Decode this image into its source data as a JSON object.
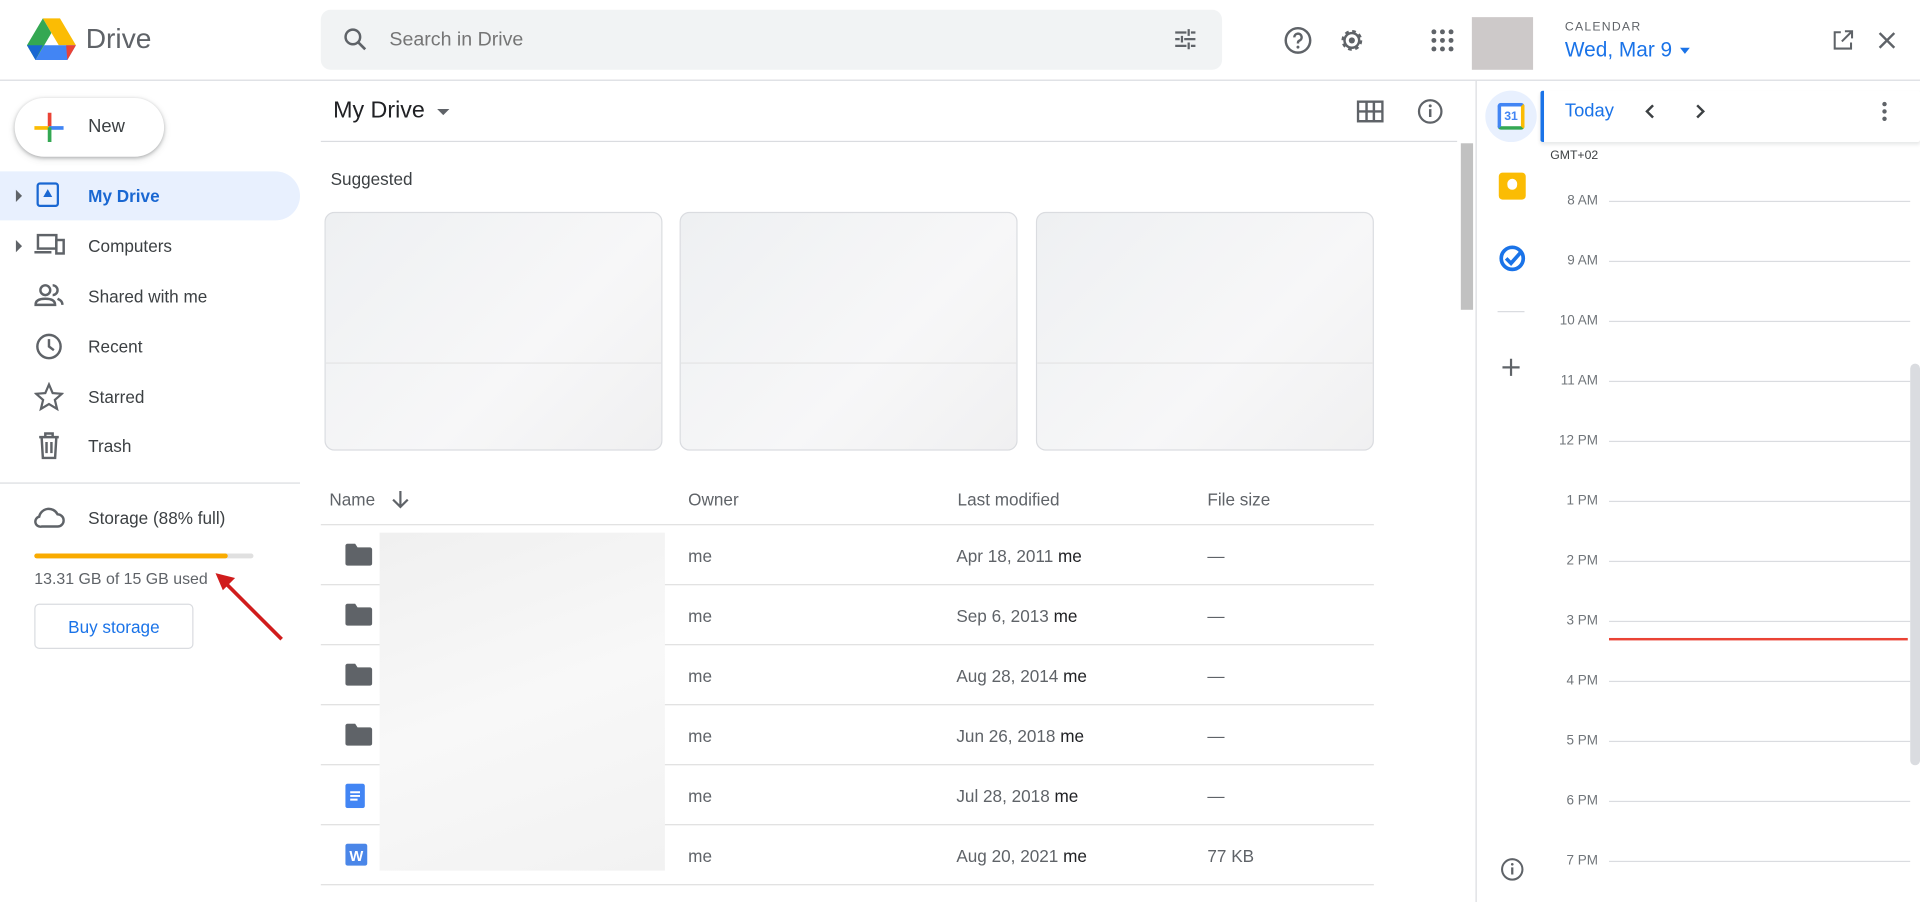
{
  "header": {
    "app_name": "Drive",
    "search_placeholder": "Search in Drive"
  },
  "calendar_header": {
    "label": "CALENDAR",
    "date": "Wed, Mar 9"
  },
  "sidebar": {
    "new_label": "New",
    "items": [
      {
        "label": "My Drive"
      },
      {
        "label": "Computers"
      },
      {
        "label": "Shared with me"
      },
      {
        "label": "Recent"
      },
      {
        "label": "Starred"
      },
      {
        "label": "Trash"
      }
    ],
    "storage": {
      "label": "Storage (88% full)",
      "used_text": "13.31 GB of 15 GB used",
      "percent": 88,
      "buy_label": "Buy storage"
    }
  },
  "main": {
    "title": "My Drive",
    "suggested_label": "Suggested",
    "columns": {
      "name": "Name",
      "owner": "Owner",
      "modified": "Last modified",
      "size": "File size"
    },
    "rows": [
      {
        "type": "folder",
        "owner": "me",
        "modified": "Apr 18, 2011",
        "modified_by": "me",
        "size": "—"
      },
      {
        "type": "folder",
        "owner": "me",
        "modified": "Sep 6, 2013",
        "modified_by": "me",
        "size": "—"
      },
      {
        "type": "folder",
        "owner": "me",
        "modified": "Aug 28, 2014",
        "modified_by": "me",
        "size": "—"
      },
      {
        "type": "folder",
        "owner": "me",
        "modified": "Jun 26, 2018",
        "modified_by": "me",
        "size": "—"
      },
      {
        "type": "doc",
        "owner": "me",
        "modified": "Jul 28, 2018",
        "modified_by": "me",
        "size": "—"
      },
      {
        "type": "word",
        "owner": "me",
        "modified": "Aug 20, 2021",
        "modified_by": "me",
        "size": "77 KB"
      }
    ]
  },
  "calendar": {
    "today_label": "Today",
    "timezone": "GMT+02",
    "calendar_icon_day": "31",
    "hours": [
      "8 AM",
      "9 AM",
      "10 AM",
      "11 AM",
      "12 PM",
      "1 PM",
      "2 PM",
      "3 PM",
      "4 PM",
      "5 PM",
      "6 PM",
      "7 PM"
    ],
    "current_time_line_after": "3 PM"
  },
  "colors": {
    "accent": "#1a73e8",
    "storage_bar": "#f9ab00",
    "now_line": "#ea4335",
    "arrow": "#d01c1c"
  }
}
